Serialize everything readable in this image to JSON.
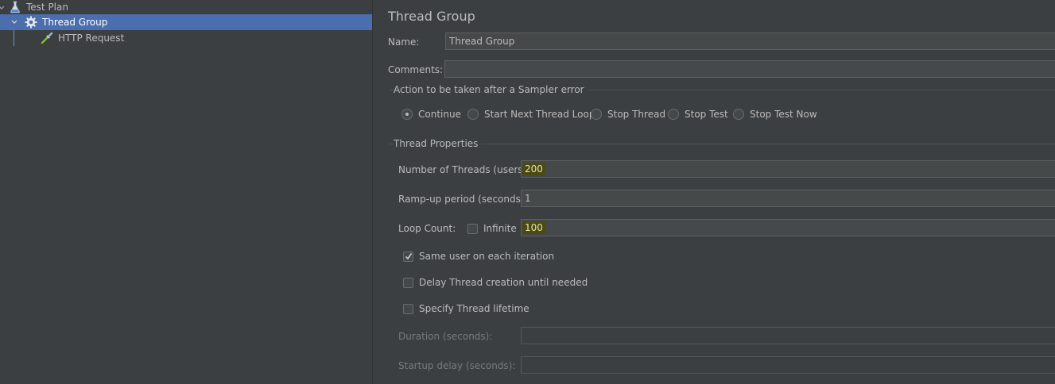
{
  "tree": {
    "items": [
      {
        "label": "Test Plan",
        "icon": "flask-icon",
        "expanded": true,
        "selected": false
      },
      {
        "label": "Thread Group",
        "icon": "gear-icon",
        "expanded": true,
        "selected": true
      },
      {
        "label": "HTTP Request",
        "icon": "pipette-icon",
        "selected": false
      }
    ]
  },
  "panel": {
    "title": "Thread Group",
    "name_label": "Name:",
    "name_value": "Thread Group",
    "comments_label": "Comments:",
    "comments_value": "",
    "sampler_error": {
      "legend": "Action to be taken after a Sampler error",
      "options": [
        "Continue",
        "Start Next Thread Loop",
        "Stop Thread",
        "Stop Test",
        "Stop Test Now"
      ],
      "selected": "Continue"
    },
    "thread_props": {
      "legend": "Thread Properties",
      "threads_label": "Number of Threads (users):",
      "threads_value": "200",
      "rampup_label": "Ramp-up period (seconds):",
      "rampup_value": "1",
      "loop_label": "Loop Count:",
      "infinite_label": "Infinite",
      "infinite_checked": false,
      "loop_value": "100",
      "same_user_label": "Same user on each iteration",
      "same_user_checked": true,
      "delay_label": "Delay Thread creation until needed",
      "delay_checked": false,
      "lifetime_label": "Specify Thread lifetime",
      "lifetime_checked": false,
      "duration_label": "Duration (seconds):",
      "duration_value": "",
      "startup_label": "Startup delay (seconds):",
      "startup_value": ""
    }
  },
  "colors": {
    "background": "#3c3f41",
    "selection": "#4b6eaf",
    "highlight": "#4c4a14"
  }
}
